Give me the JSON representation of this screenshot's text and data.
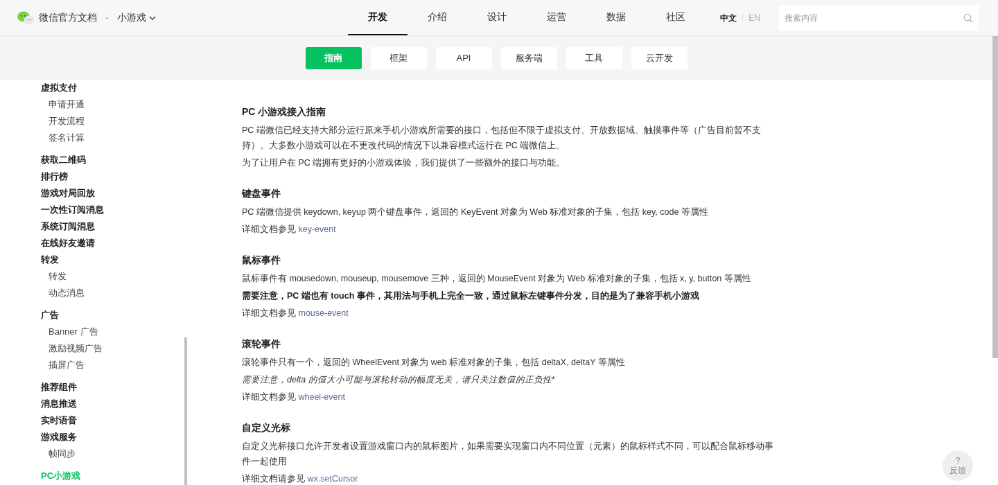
{
  "header": {
    "site_title": "微信官方文档",
    "separator": "·",
    "product": "小游戏",
    "nav": [
      {
        "label": "开发",
        "selected": true
      },
      {
        "label": "介绍",
        "selected": false
      },
      {
        "label": "设计",
        "selected": false
      },
      {
        "label": "运营",
        "selected": false
      },
      {
        "label": "数据",
        "selected": false
      },
      {
        "label": "社区",
        "selected": false
      }
    ],
    "languages": [
      {
        "label": "中文",
        "selected": true
      },
      {
        "label": "EN",
        "selected": false
      }
    ],
    "search": {
      "placeholder": "搜索内容"
    }
  },
  "subnav": [
    {
      "label": "指南",
      "selected": true
    },
    {
      "label": "框架",
      "selected": false
    },
    {
      "label": "API",
      "selected": false
    },
    {
      "label": "服务端",
      "selected": false
    },
    {
      "label": "工具",
      "selected": false
    },
    {
      "label": "云开发",
      "selected": false
    }
  ],
  "sidebar": {
    "items": [
      {
        "label": "虚拟支付",
        "selected": false,
        "children": [
          {
            "label": "申请开通",
            "selected": false
          },
          {
            "label": "开发流程",
            "selected": false
          },
          {
            "label": "签名计算",
            "selected": false
          }
        ]
      },
      {
        "label": "获取二维码",
        "selected": false
      },
      {
        "label": "排行榜",
        "selected": false
      },
      {
        "label": "游戏对局回放",
        "selected": false
      },
      {
        "label": "一次性订阅消息",
        "selected": false
      },
      {
        "label": "系统订阅消息",
        "selected": false
      },
      {
        "label": "在线好友邀请",
        "selected": false
      },
      {
        "label": "转发",
        "selected": false,
        "children": [
          {
            "label": "转发",
            "selected": false
          },
          {
            "label": "动态消息",
            "selected": false
          }
        ]
      },
      {
        "label": "广告",
        "selected": false,
        "children": [
          {
            "label": "Banner 广告",
            "selected": false
          },
          {
            "label": "激励视频广告",
            "selected": false
          },
          {
            "label": "插屏广告",
            "selected": false
          }
        ]
      },
      {
        "label": "推荐组件",
        "selected": false
      },
      {
        "label": "消息推送",
        "selected": false
      },
      {
        "label": "实时语音",
        "selected": false
      },
      {
        "label": "游戏服务",
        "selected": false,
        "children": [
          {
            "label": "帧同步",
            "selected": false
          }
        ]
      },
      {
        "label": "PC小游戏",
        "selected": true
      }
    ]
  },
  "article": {
    "sections": [
      {
        "title": "PC 小游戏接入指南",
        "paragraphs": [
          {
            "kind": "text",
            "text": "PC 端微信已经支持大部分运行原来手机小游戏所需要的接口，包括但不限于虚拟支付、开放数据域、触摸事件等（广告目前暂不支持）。大多数小游戏可以在不更改代码的情况下以兼容模式运行在 PC 端微信上。"
          },
          {
            "kind": "text",
            "text": "为了让用户在 PC 端拥有更好的小游戏体验，我们提供了一些额外的接口与功能。"
          }
        ]
      },
      {
        "title": "键盘事件",
        "paragraphs": [
          {
            "kind": "text",
            "text": "PC 端微信提供 keydown, keyup 两个键盘事件，返回的 KeyEvent 对象为 Web 标准对象的子集，包括 key, code 等属性"
          },
          {
            "kind": "ref",
            "text": "详细文档参见",
            "link": "key-event"
          }
        ]
      },
      {
        "title": "鼠标事件",
        "paragraphs": [
          {
            "kind": "text",
            "text": "鼠标事件有 mousedown, mouseup, mousemove 三种，返回的 MouseEvent 对象为 Web 标准对象的子集，包括 x, y, button 等属性"
          },
          {
            "kind": "bold",
            "text": "需要注意，PC 端也有 touch 事件，其用法与手机上完全一致，通过鼠标左键事件分发，目的是为了兼容手机小游戏"
          },
          {
            "kind": "ref",
            "text": "详细文档参见",
            "link": "mouse-event"
          }
        ]
      },
      {
        "title": "滚轮事件",
        "paragraphs": [
          {
            "kind": "text",
            "text": "滚轮事件只有一个，返回的 WheelEvent 对象为 web 标准对象的子集，包括 deltaX, deltaY 等属性"
          },
          {
            "kind": "italic",
            "text": "需要注意，delta 的值大小可能与滚轮转动的幅度无关，请只关注数值的正负性*"
          },
          {
            "kind": "ref",
            "text": "详细文档参见",
            "link": "wheel-event"
          }
        ]
      },
      {
        "title": "自定义光标",
        "paragraphs": [
          {
            "kind": "text",
            "text": "自定义光标接口允许开发者设置游戏窗口内的鼠标图片，如果需要实现窗口内不同位置（元素）的鼠标样式不同，可以配合鼠标移动事件一起使用"
          },
          {
            "kind": "ref",
            "text": "详细文档请参见",
            "link": "wx.setCursor"
          }
        ]
      }
    ]
  },
  "feedback": {
    "icon": "?",
    "label": "反馈"
  }
}
